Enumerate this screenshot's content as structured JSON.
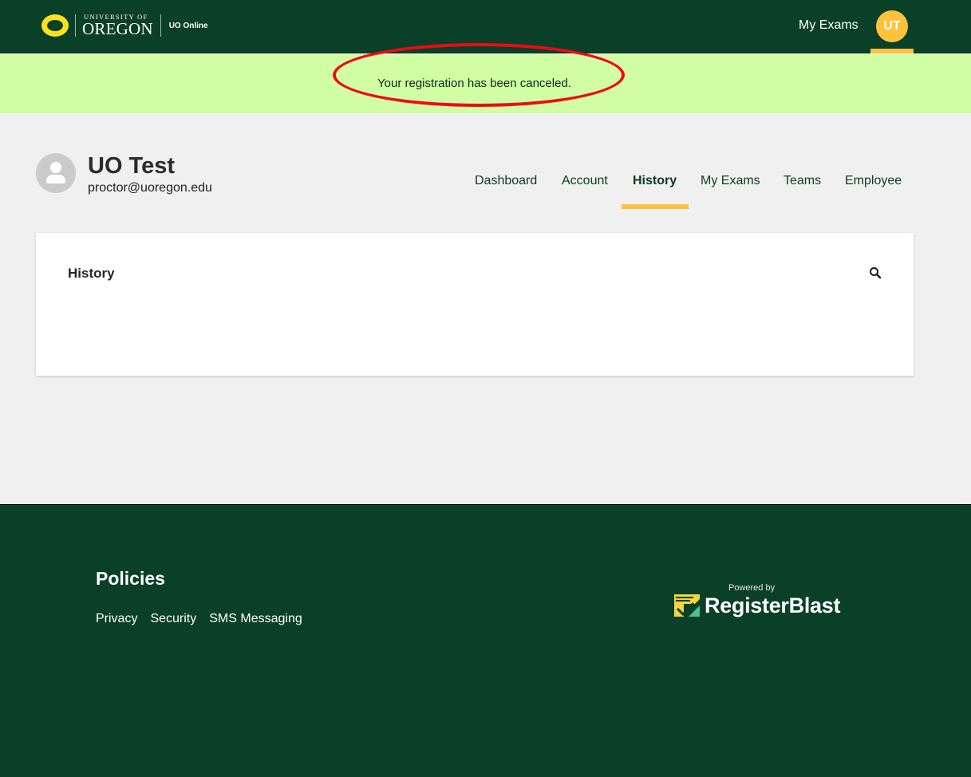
{
  "header": {
    "university_small": "UNIVERSITY OF",
    "university_big": "OREGON",
    "site_name": "UO Online",
    "my_exams_link": "My Exams",
    "user_initials": "UT",
    "brand_color": "#0a4027",
    "accent_color": "#fcc33a"
  },
  "alert": {
    "message": "Your registration has been canceled.",
    "background": "#d1fda4"
  },
  "profile": {
    "name": "UO Test",
    "email": "proctor@uoregon.edu",
    "avatar_icon": "user-silhouette-icon"
  },
  "tabs": [
    {
      "label": "Dashboard",
      "active": false
    },
    {
      "label": "Account",
      "active": false
    },
    {
      "label": "History",
      "active": true
    },
    {
      "label": "My Exams",
      "active": false
    },
    {
      "label": "Teams",
      "active": false
    },
    {
      "label": "Employee",
      "active": false
    }
  ],
  "card": {
    "title": "History",
    "search_icon": "search-icon"
  },
  "footer": {
    "title": "Policies",
    "links": [
      "Privacy",
      "Security",
      "SMS Messaging"
    ],
    "powered_by": "Powered by",
    "brand": "RegisterBlast"
  }
}
